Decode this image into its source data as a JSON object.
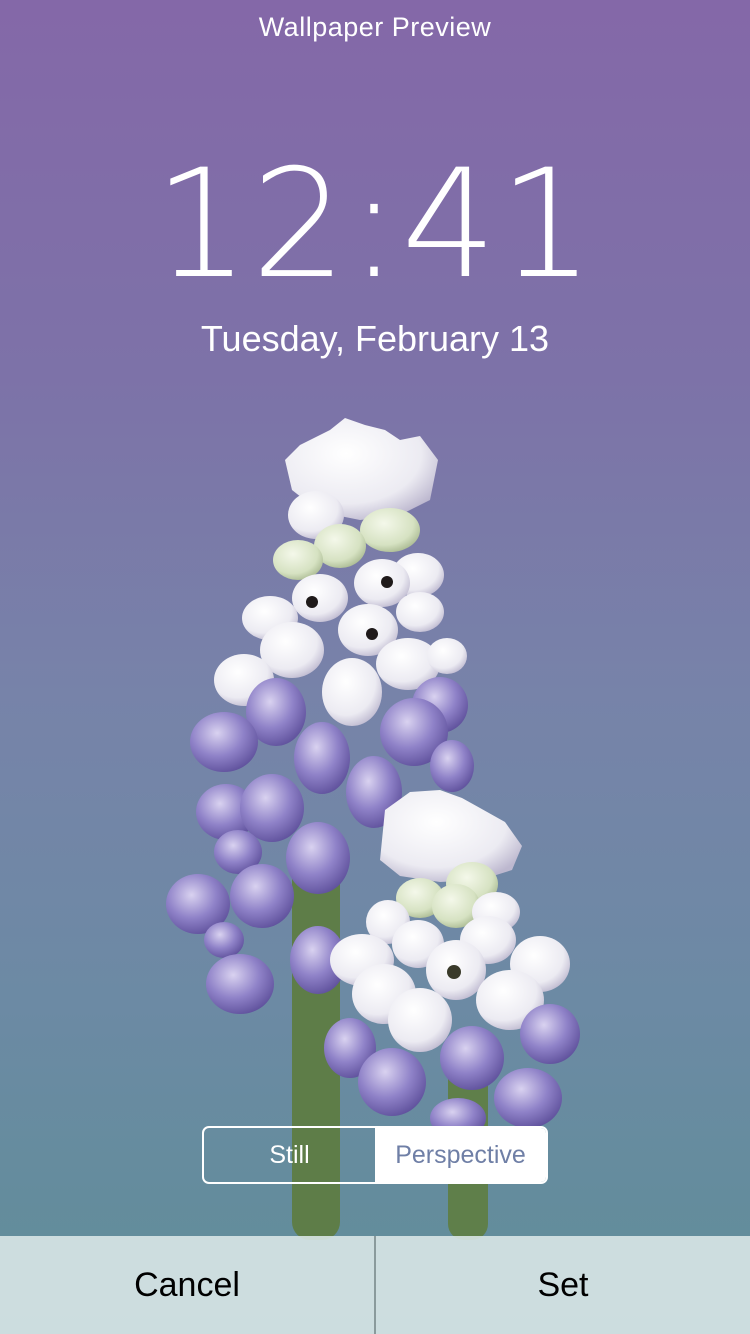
{
  "header": {
    "title": "Wallpaper Preview"
  },
  "lockscreen": {
    "time": "12:41",
    "date": "Tuesday, February 13"
  },
  "mode_toggle": {
    "options": [
      "Still",
      "Perspective"
    ],
    "selected": "Perspective"
  },
  "actions": {
    "cancel_label": "Cancel",
    "set_label": "Set"
  },
  "colors": {
    "gradient_top": "#8468a8",
    "gradient_bottom": "#5f8e98",
    "stem": "#5e7d48",
    "bud_purple": "#8a7cc4",
    "bud_white": "#f2f0f4"
  }
}
